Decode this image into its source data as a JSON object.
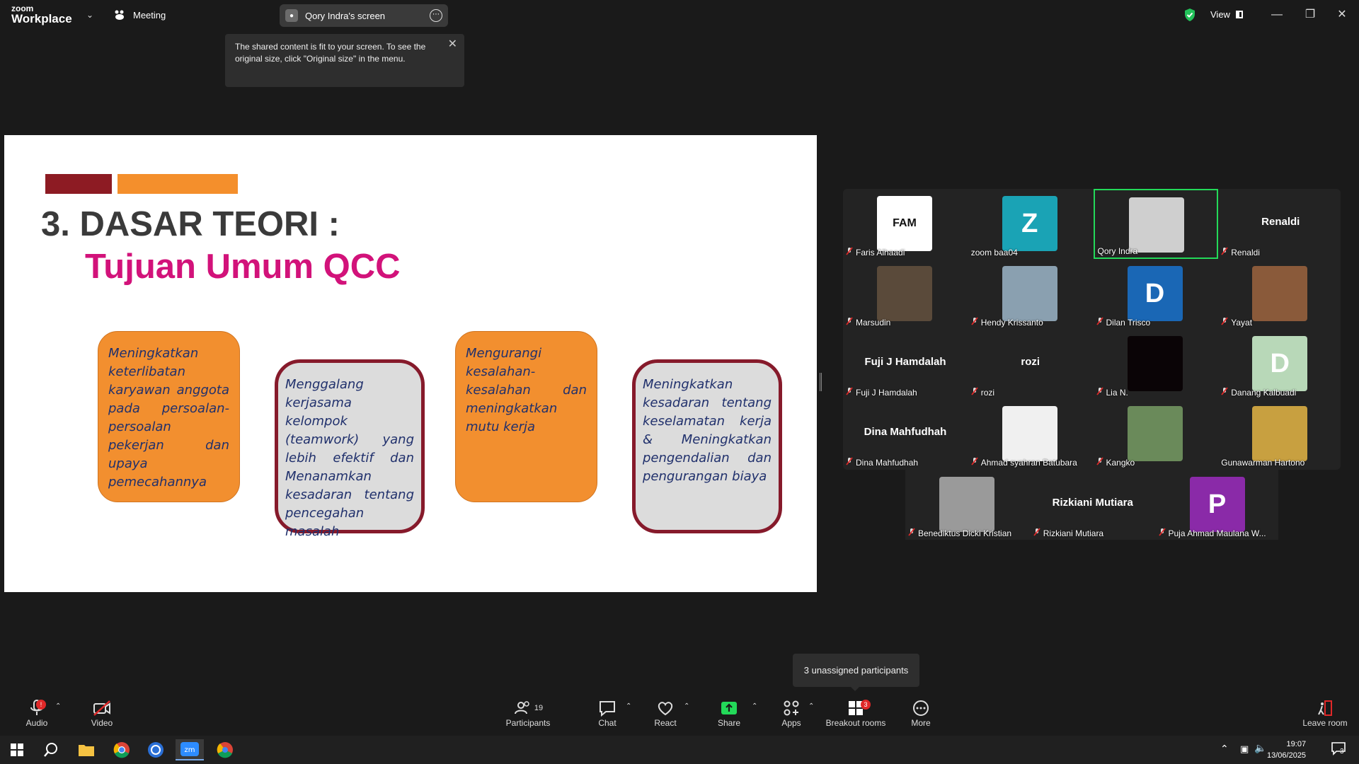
{
  "titlebar": {
    "brand_top": "zoom",
    "brand_bottom": "Workplace",
    "meeting_label": "Meeting",
    "share_pill_label": "Qory Indra's screen",
    "view_label": "View"
  },
  "tooltip": {
    "text": "The shared content is fit to your screen. To see the original size, click \"Original size\" in the menu."
  },
  "slide": {
    "title": "3. DASAR TEORI :",
    "subtitle": "Tujuan Umum QCC",
    "boxes": [
      "Meningkatkan keterlibatan karyawan anggota pada persoalan-persoalan pekerjan dan upaya pemecahannya",
      "Menggalang kerjasama kelompok (teamwork) yang lebih efektif dan Menanamkan kesadaran tentang pencegahan masalah",
      "Mengurangi kesalahan-kesalahan dan meningkatkan mutu kerja",
      "Meningkatkan kesadaran tentang keselamatan kerja & Meningkatkan pengendalian dan pengurangan biaya"
    ]
  },
  "participants": [
    {
      "name": "Faris Alhaadi",
      "avatar_text": "FAM",
      "avatar_color": "#ffffff",
      "muted": true
    },
    {
      "name": "zoom baa04",
      "avatar_text": "Z",
      "avatar_color": "#1aa3b5",
      "muted": false
    },
    {
      "name": "Qory Indra",
      "avatar_text": "",
      "avatar_color": "#cfcfcf",
      "muted": false,
      "active": true
    },
    {
      "name": "Renaldi",
      "display_name": "Renaldi",
      "muted": true
    },
    {
      "name": "Marsudin",
      "avatar_text": "",
      "avatar_color": "#5a4a3a",
      "muted": true
    },
    {
      "name": "Hendy Krissanto",
      "avatar_text": "",
      "avatar_color": "#8aa0b0",
      "muted": true
    },
    {
      "name": "Dilan Trisco",
      "avatar_text": "D",
      "avatar_color": "#1a67b5",
      "muted": true
    },
    {
      "name": "Yayat",
      "avatar_text": "",
      "avatar_color": "#8a5a3a",
      "muted": true
    },
    {
      "name": "Fuji J Hamdalah",
      "display_name": "Fuji J Hamdalah",
      "muted": true
    },
    {
      "name": "rozi",
      "display_name": "rozi",
      "muted": true
    },
    {
      "name": "Lia N.",
      "avatar_text": "",
      "avatar_color": "#0a0406",
      "muted": true
    },
    {
      "name": "Danang Kalbuadi",
      "avatar_text": "D",
      "avatar_color": "#b8d8b8",
      "muted": true
    },
    {
      "name": "Dina Mahfudhah",
      "display_name": "Dina Mahfudhah",
      "muted": true
    },
    {
      "name": "Ahmad syahran Batubara",
      "avatar_text": "",
      "avatar_color": "#f0f0f0",
      "muted": true
    },
    {
      "name": "Kangko",
      "avatar_text": "",
      "avatar_color": "#6a8a5a",
      "muted": true
    },
    {
      "name": "Gunawarman Hartono",
      "avatar_text": "",
      "avatar_color": "#c8a040",
      "muted": false
    },
    {
      "name": "Benediktus Dicki Kristian",
      "avatar_text": "",
      "avatar_color": "#9a9a9a",
      "muted": true
    },
    {
      "name": "Rizkiani Mutiara",
      "display_name": "Rizkiani Mutiara",
      "muted": true
    },
    {
      "name": "Puja Ahmad Maulana W...",
      "avatar_text": "P",
      "avatar_color": "#8a2aa8",
      "muted": true
    }
  ],
  "unassigned_tooltip": "3 unassigned participants",
  "toolbar": {
    "audio": "Audio",
    "video": "Video",
    "participants": "Participants",
    "participants_count": "19",
    "chat": "Chat",
    "react": "React",
    "share": "Share",
    "apps": "Apps",
    "breakout": "Breakout rooms",
    "breakout_badge": "3",
    "more": "More",
    "leave": "Leave room"
  },
  "taskbar": {
    "time": "19:07",
    "date": "13/06/2025",
    "notif_count": "3"
  },
  "colors": {
    "accent_dark_red": "#8d1b23",
    "accent_orange": "#f48f2c",
    "subtitle_magenta": "#d2127a",
    "share_green": "#23d959"
  }
}
